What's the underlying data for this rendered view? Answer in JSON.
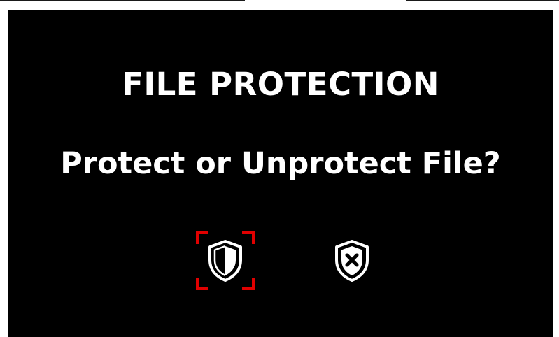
{
  "dialog": {
    "title": "FILE PROTECTION",
    "question": "Protect or Unprotect File?",
    "options": [
      {
        "icon": "shield-half-icon",
        "selected": true
      },
      {
        "icon": "shield-x-icon",
        "selected": false
      }
    ],
    "selection_color": "#e00000",
    "background": "#000000",
    "text_color": "#ffffff"
  }
}
